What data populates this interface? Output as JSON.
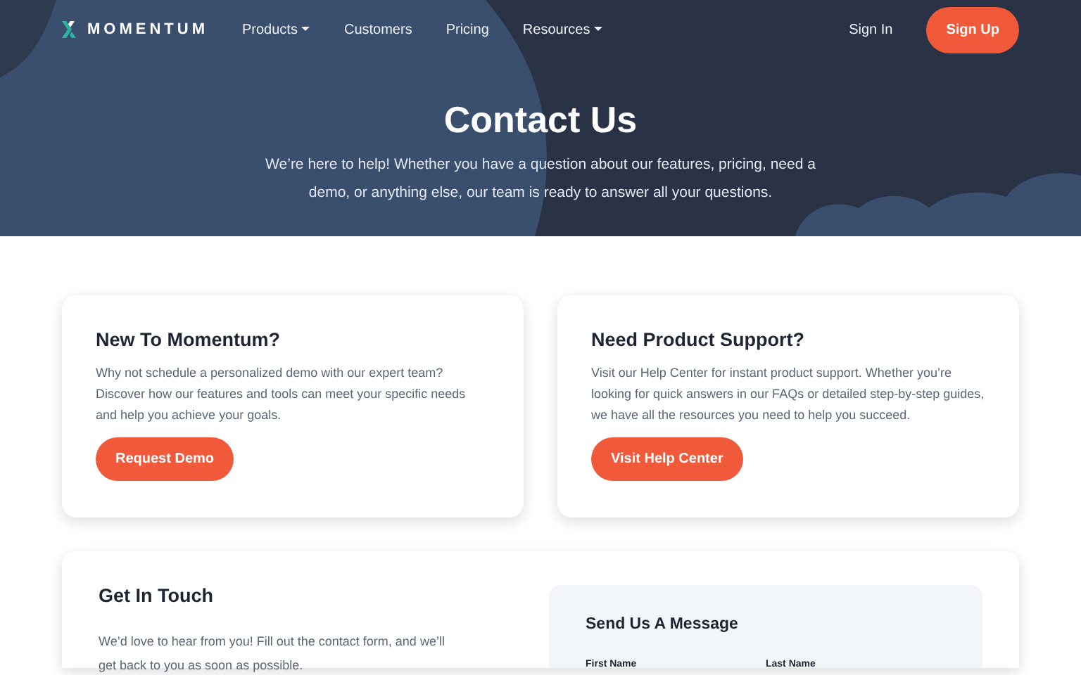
{
  "navbar": {
    "brand": "MOMENTUM",
    "links": [
      {
        "label": "Products",
        "dropdown": true
      },
      {
        "label": "Customers",
        "dropdown": false
      },
      {
        "label": "Pricing",
        "dropdown": false
      },
      {
        "label": "Resources",
        "dropdown": true
      }
    ],
    "sign_in": "Sign In",
    "sign_up": "Sign Up"
  },
  "hero": {
    "title": "Contact Us",
    "subtitle": "We’re here to help! Whether you have a question about our features, pricing, need a demo, or anything else, our team is ready to answer all your questions."
  },
  "cards": [
    {
      "title": "New To Momentum?",
      "text": "Why not schedule a personalized demo with our expert team? Discover how our features and tools can meet your specific needs and help you achieve your goals.",
      "button": "Request Demo"
    },
    {
      "title": "Need Product Support?",
      "text": "Visit our Help Center for instant product support. Whether you’re looking for quick answers in our FAQs or detailed step-by-step guides, we have all the resources you need to help you succeed.",
      "button": "Visit Help Center"
    }
  ],
  "contact": {
    "title": "Get In Touch",
    "text": "We’d love to hear from you! Fill out the contact form, and we’ll get back to you as soon as possible.",
    "form": {
      "title": "Send Us A Message",
      "fields": [
        {
          "label": "First Name"
        },
        {
          "label": "Last Name"
        }
      ]
    }
  }
}
